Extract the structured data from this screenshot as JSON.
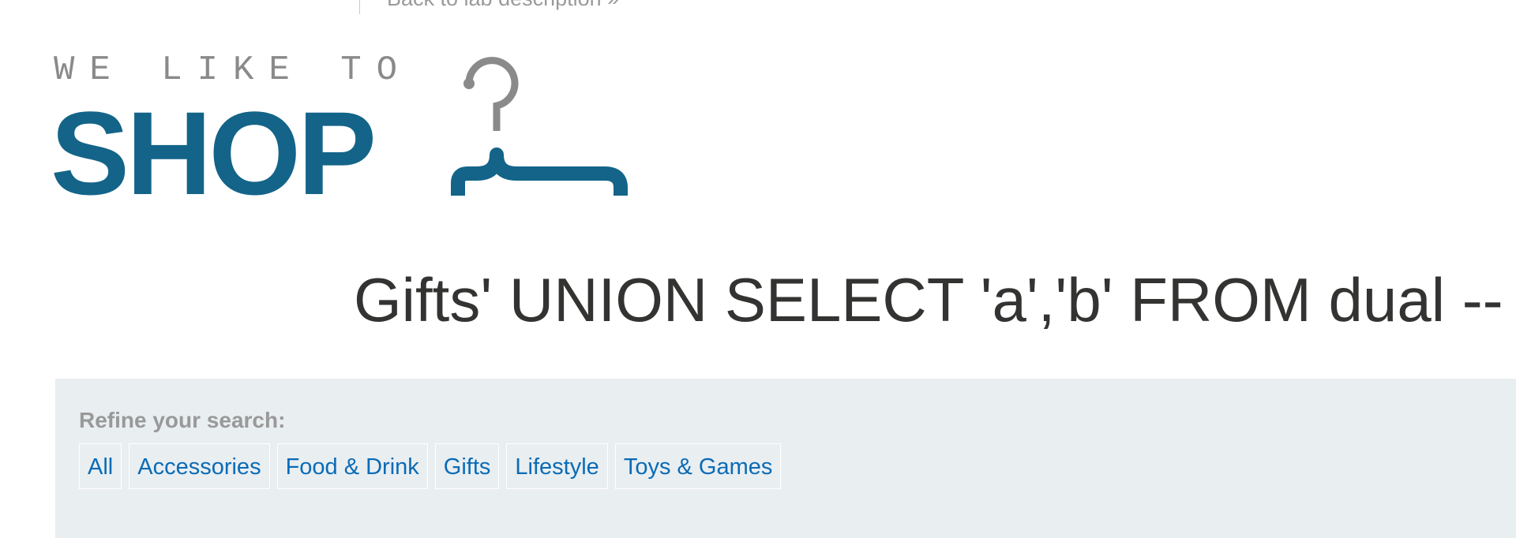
{
  "header": {
    "back_link_label": "Back to lab description »"
  },
  "logo": {
    "tagline": "WE LIKE TO",
    "word": "SHOP",
    "brand_color": "#136488",
    "tagline_color": "#8a8a8a",
    "icon": "hanger-icon"
  },
  "main": {
    "search_title": "Gifts' UNION SELECT 'a','b' FROM dual --"
  },
  "filters": {
    "label": "Refine your search:",
    "link_color": "#0a6bb5",
    "panel_color": "#e9eef1",
    "items": [
      {
        "label": "All"
      },
      {
        "label": "Accessories"
      },
      {
        "label": "Food & Drink"
      },
      {
        "label": "Gifts"
      },
      {
        "label": "Lifestyle"
      },
      {
        "label": "Toys & Games"
      }
    ]
  }
}
